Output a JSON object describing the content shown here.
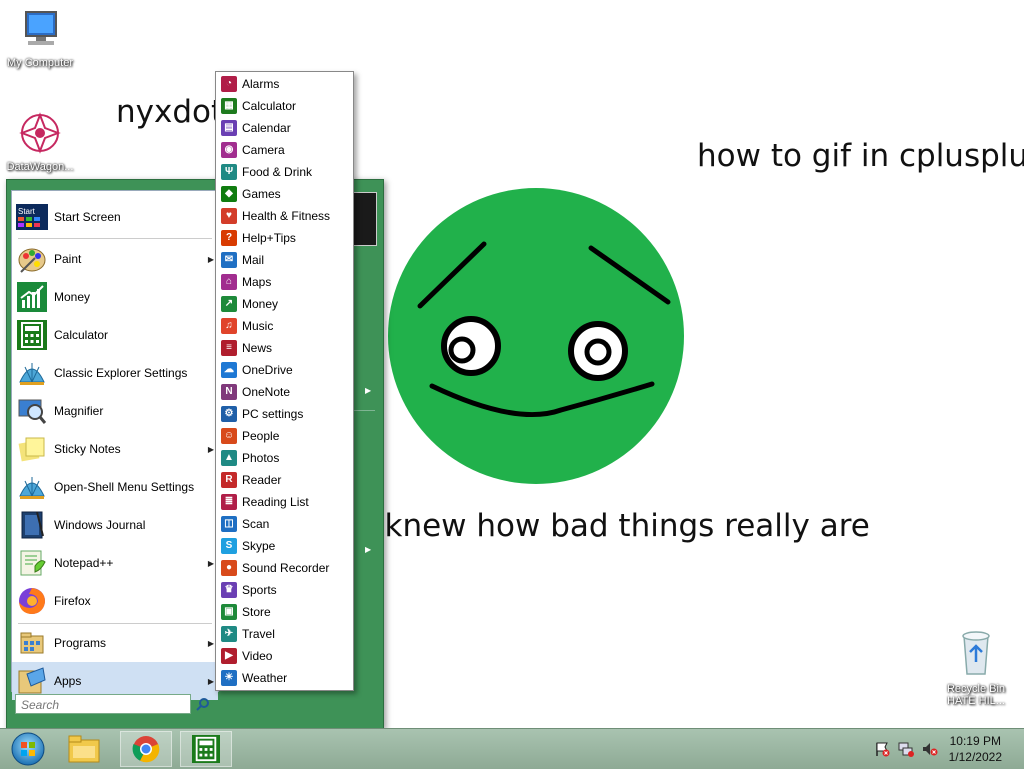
{
  "desktop": {
    "texts": [
      "nyxdot",
      "how to gif in cplusplus",
      "u knew how bad things really are"
    ],
    "icons": {
      "my_computer": "My Computer",
      "datawagon": "DataWagon...",
      "recycle_bin_line1": "Recycle Bin",
      "recycle_bin_line2": "HATE HIL..."
    },
    "face_color": "#21b14b"
  },
  "start_menu": {
    "items": [
      {
        "label": "Start Screen",
        "icon": "start-screen-icon",
        "submenu": false
      },
      {
        "label": "Paint",
        "icon": "paint-palette-icon",
        "submenu": true
      },
      {
        "label": "Money",
        "icon": "money-chart-icon",
        "submenu": false
      },
      {
        "label": "Calculator",
        "icon": "calculator-icon",
        "submenu": false
      },
      {
        "label": "Classic Explorer Settings",
        "icon": "shell-icon",
        "submenu": false
      },
      {
        "label": "Magnifier",
        "icon": "magnifier-icon",
        "submenu": false
      },
      {
        "label": "Sticky Notes",
        "icon": "sticky-notes-icon",
        "submenu": true
      },
      {
        "label": "Open-Shell Menu Settings",
        "icon": "shell-icon",
        "submenu": false
      },
      {
        "label": "Windows Journal",
        "icon": "journal-icon",
        "submenu": false
      },
      {
        "label": "Notepad++",
        "icon": "notepad-plus-icon",
        "submenu": true
      },
      {
        "label": "Firefox",
        "icon": "firefox-icon",
        "submenu": false
      }
    ],
    "programs_label": "Programs",
    "apps_label": "Apps",
    "search_placeholder": "Search",
    "accent": "#3e9257"
  },
  "apps_submenu": {
    "items": [
      {
        "label": "Alarms",
        "color": "#b01e48",
        "icon": "alarm-clock-icon"
      },
      {
        "label": "Calculator",
        "color": "#1e7b1e",
        "icon": "calculator-icon"
      },
      {
        "label": "Calendar",
        "color": "#6a3fb3",
        "icon": "calendar-icon"
      },
      {
        "label": "Camera",
        "color": "#a12d8f",
        "icon": "camera-icon"
      },
      {
        "label": "Food & Drink",
        "color": "#1f8a84",
        "icon": "food-drink-icon"
      },
      {
        "label": "Games",
        "color": "#107c10",
        "icon": "games-controller-icon"
      },
      {
        "label": "Health & Fitness",
        "color": "#d33d2a",
        "icon": "health-heart-icon"
      },
      {
        "label": "Help+Tips",
        "color": "#d83b01",
        "icon": "help-icon"
      },
      {
        "label": "Mail",
        "color": "#1f6fc3",
        "icon": "mail-icon"
      },
      {
        "label": "Maps",
        "color": "#a12d8f",
        "icon": "maps-icon"
      },
      {
        "label": "Money",
        "color": "#1e8a3a",
        "icon": "money-chart-icon"
      },
      {
        "label": "Music",
        "color": "#e0442b",
        "icon": "music-headphones-icon"
      },
      {
        "label": "News",
        "color": "#b01e2e",
        "icon": "news-icon"
      },
      {
        "label": "OneDrive",
        "color": "#1e78d4",
        "icon": "onedrive-cloud-icon"
      },
      {
        "label": "OneNote",
        "color": "#80397b",
        "icon": "onenote-icon"
      },
      {
        "label": "PC settings",
        "color": "#1f5fa8",
        "icon": "settings-gear-icon"
      },
      {
        "label": "People",
        "color": "#d84a1b",
        "icon": "people-icon"
      },
      {
        "label": "Photos",
        "color": "#1f8a84",
        "icon": "photos-icon"
      },
      {
        "label": "Reader",
        "color": "#c42a2a",
        "icon": "reader-icon"
      },
      {
        "label": "Reading List",
        "color": "#b01e48",
        "icon": "reading-list-icon"
      },
      {
        "label": "Scan",
        "color": "#1f6fc3",
        "icon": "scan-icon"
      },
      {
        "label": "Skype",
        "color": "#1fa0e0",
        "icon": "skype-icon"
      },
      {
        "label": "Sound Recorder",
        "color": "#d84a1b",
        "icon": "microphone-icon"
      },
      {
        "label": "Sports",
        "color": "#6a3fb3",
        "icon": "trophy-icon"
      },
      {
        "label": "Store",
        "color": "#1e8a3a",
        "icon": "store-icon"
      },
      {
        "label": "Travel",
        "color": "#1f8a84",
        "icon": "travel-icon"
      },
      {
        "label": "Video",
        "color": "#b01e2e",
        "icon": "video-icon"
      },
      {
        "label": "Weather",
        "color": "#1f6fc3",
        "icon": "weather-sun-icon"
      }
    ]
  },
  "taskbar": {
    "time": "10:19 PM",
    "date": "1/12/2022",
    "pinned": [
      "start-orb-icon",
      "file-explorer-icon",
      "chrome-icon",
      "calculator-icon"
    ],
    "tray": [
      "action-center-flag-icon",
      "network-icon",
      "volume-muted-icon"
    ]
  }
}
